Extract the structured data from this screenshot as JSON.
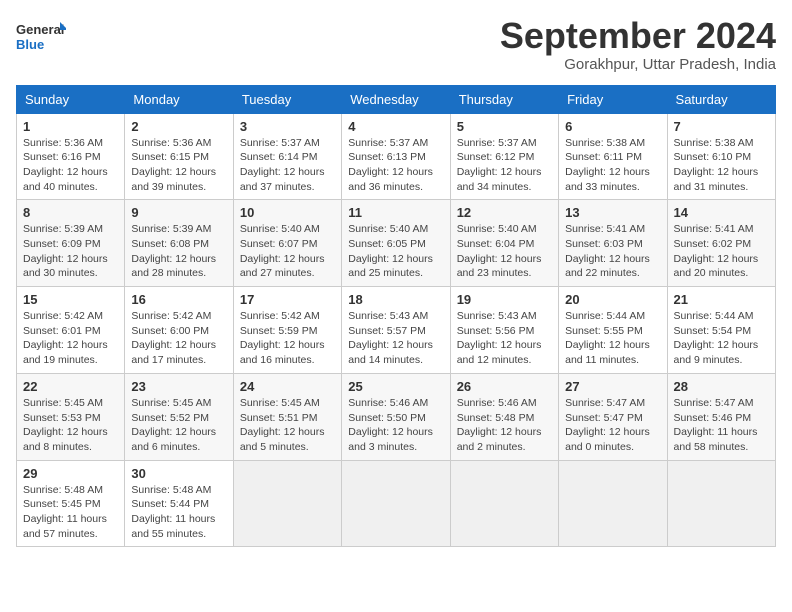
{
  "header": {
    "logo_line1": "General",
    "logo_line2": "Blue",
    "month_title": "September 2024",
    "subtitle": "Gorakhpur, Uttar Pradesh, India"
  },
  "weekdays": [
    "Sunday",
    "Monday",
    "Tuesday",
    "Wednesday",
    "Thursday",
    "Friday",
    "Saturday"
  ],
  "weeks": [
    [
      {
        "day": "1",
        "sunrise": "5:36 AM",
        "sunset": "6:16 PM",
        "daylight": "12 hours and 40 minutes."
      },
      {
        "day": "2",
        "sunrise": "5:36 AM",
        "sunset": "6:15 PM",
        "daylight": "12 hours and 39 minutes."
      },
      {
        "day": "3",
        "sunrise": "5:37 AM",
        "sunset": "6:14 PM",
        "daylight": "12 hours and 37 minutes."
      },
      {
        "day": "4",
        "sunrise": "5:37 AM",
        "sunset": "6:13 PM",
        "daylight": "12 hours and 36 minutes."
      },
      {
        "day": "5",
        "sunrise": "5:37 AM",
        "sunset": "6:12 PM",
        "daylight": "12 hours and 34 minutes."
      },
      {
        "day": "6",
        "sunrise": "5:38 AM",
        "sunset": "6:11 PM",
        "daylight": "12 hours and 33 minutes."
      },
      {
        "day": "7",
        "sunrise": "5:38 AM",
        "sunset": "6:10 PM",
        "daylight": "12 hours and 31 minutes."
      }
    ],
    [
      {
        "day": "8",
        "sunrise": "5:39 AM",
        "sunset": "6:09 PM",
        "daylight": "12 hours and 30 minutes."
      },
      {
        "day": "9",
        "sunrise": "5:39 AM",
        "sunset": "6:08 PM",
        "daylight": "12 hours and 28 minutes."
      },
      {
        "day": "10",
        "sunrise": "5:40 AM",
        "sunset": "6:07 PM",
        "daylight": "12 hours and 27 minutes."
      },
      {
        "day": "11",
        "sunrise": "5:40 AM",
        "sunset": "6:05 PM",
        "daylight": "12 hours and 25 minutes."
      },
      {
        "day": "12",
        "sunrise": "5:40 AM",
        "sunset": "6:04 PM",
        "daylight": "12 hours and 23 minutes."
      },
      {
        "day": "13",
        "sunrise": "5:41 AM",
        "sunset": "6:03 PM",
        "daylight": "12 hours and 22 minutes."
      },
      {
        "day": "14",
        "sunrise": "5:41 AM",
        "sunset": "6:02 PM",
        "daylight": "12 hours and 20 minutes."
      }
    ],
    [
      {
        "day": "15",
        "sunrise": "5:42 AM",
        "sunset": "6:01 PM",
        "daylight": "12 hours and 19 minutes."
      },
      {
        "day": "16",
        "sunrise": "5:42 AM",
        "sunset": "6:00 PM",
        "daylight": "12 hours and 17 minutes."
      },
      {
        "day": "17",
        "sunrise": "5:42 AM",
        "sunset": "5:59 PM",
        "daylight": "12 hours and 16 minutes."
      },
      {
        "day": "18",
        "sunrise": "5:43 AM",
        "sunset": "5:57 PM",
        "daylight": "12 hours and 14 minutes."
      },
      {
        "day": "19",
        "sunrise": "5:43 AM",
        "sunset": "5:56 PM",
        "daylight": "12 hours and 12 minutes."
      },
      {
        "day": "20",
        "sunrise": "5:44 AM",
        "sunset": "5:55 PM",
        "daylight": "12 hours and 11 minutes."
      },
      {
        "day": "21",
        "sunrise": "5:44 AM",
        "sunset": "5:54 PM",
        "daylight": "12 hours and 9 minutes."
      }
    ],
    [
      {
        "day": "22",
        "sunrise": "5:45 AM",
        "sunset": "5:53 PM",
        "daylight": "12 hours and 8 minutes."
      },
      {
        "day": "23",
        "sunrise": "5:45 AM",
        "sunset": "5:52 PM",
        "daylight": "12 hours and 6 minutes."
      },
      {
        "day": "24",
        "sunrise": "5:45 AM",
        "sunset": "5:51 PM",
        "daylight": "12 hours and 5 minutes."
      },
      {
        "day": "25",
        "sunrise": "5:46 AM",
        "sunset": "5:50 PM",
        "daylight": "12 hours and 3 minutes."
      },
      {
        "day": "26",
        "sunrise": "5:46 AM",
        "sunset": "5:48 PM",
        "daylight": "12 hours and 2 minutes."
      },
      {
        "day": "27",
        "sunrise": "5:47 AM",
        "sunset": "5:47 PM",
        "daylight": "12 hours and 0 minutes."
      },
      {
        "day": "28",
        "sunrise": "5:47 AM",
        "sunset": "5:46 PM",
        "daylight": "11 hours and 58 minutes."
      }
    ],
    [
      {
        "day": "29",
        "sunrise": "5:48 AM",
        "sunset": "5:45 PM",
        "daylight": "11 hours and 57 minutes."
      },
      {
        "day": "30",
        "sunrise": "5:48 AM",
        "sunset": "5:44 PM",
        "daylight": "11 hours and 55 minutes."
      },
      null,
      null,
      null,
      null,
      null
    ]
  ]
}
